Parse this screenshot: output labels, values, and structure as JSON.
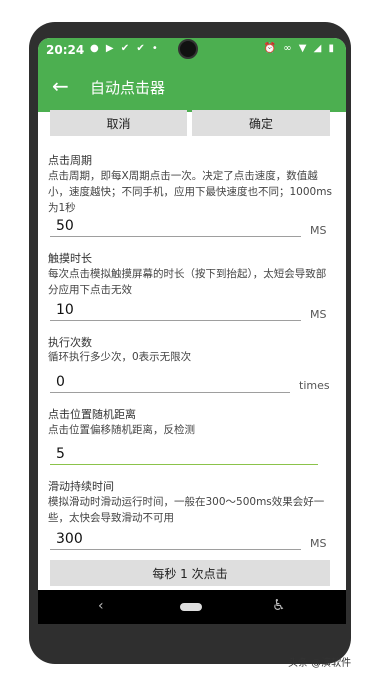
{
  "status_bar": {
    "time": "20:24"
  },
  "app_bar": {
    "title": "自动点击器"
  },
  "buttons": {
    "cancel": "取消",
    "ok": "确定",
    "bottom": "每秒 1 次点击"
  },
  "settings": [
    {
      "title": "点击周期",
      "desc": "点击周期，即每X周期点击一次。决定了点击速度，数值越小，速度越快；不同手机，应用下最快速度也不同；1000ms为1秒",
      "value": "50",
      "unit": "MS"
    },
    {
      "title": "触摸时长",
      "desc": "每次点击模拟触摸屏幕的时长（按下到抬起），太短会导致部分应用下点击无效",
      "value": "10",
      "unit": "MS"
    },
    {
      "title": "执行次数",
      "desc": "循环执行多少次，0表示无限次",
      "value": "0",
      "unit": "times"
    },
    {
      "title": "点击位置随机距离",
      "desc": "点击位置偏移随机距离，反检测",
      "value": "5",
      "unit": ""
    },
    {
      "title": "滑动持续时间",
      "desc": "模拟滑动时滑动运行时间，一般在300～500ms效果会好一些，太快会导致滑动不可用",
      "value": "300",
      "unit": "MS"
    }
  ],
  "watermark": "头条 @演软件"
}
